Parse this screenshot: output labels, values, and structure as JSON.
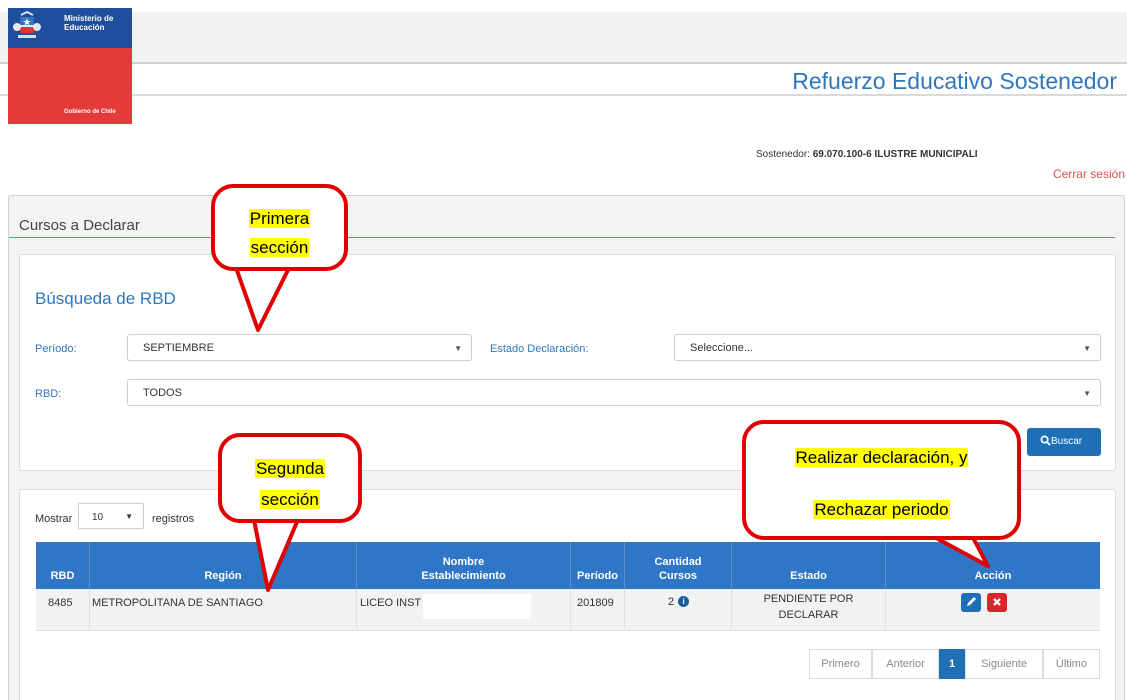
{
  "header": {
    "logo": {
      "line1": "Ministerio de",
      "line2": "Educación",
      "line3": "Gobierno de Chile"
    },
    "app_title": "Refuerzo Educativo Sostenedor",
    "sostenedor_label": "Sostenedor:",
    "sostenedor_value": "69.070.100-6 ILUSTRE MUNICIPALI",
    "logout": "Cerrar sesión"
  },
  "panel": {
    "title": "Cursos a Declarar"
  },
  "search": {
    "title": "Búsqueda de RBD",
    "periodo_label": "Período:",
    "periodo_value": "SEPTIEMBRE",
    "estado_label": "Estado Declaración:",
    "estado_value": "Seleccione...",
    "rbd_label": "RBD:",
    "rbd_value": "TODOS",
    "buscar_label": "Buscar"
  },
  "table": {
    "mostrar_label": "Mostrar",
    "page_length": "10",
    "registros_label": "registros",
    "columns": {
      "rbd": "RBD",
      "region": "Región",
      "nombre_l1": "Nombre",
      "nombre_l2": "Establecimiento",
      "periodo": "Período",
      "cantidad_l1": "Cantidad",
      "cantidad_l2": "Cursos",
      "estado": "Estado",
      "accion": "Acción"
    },
    "rows": [
      {
        "rbd": "8485",
        "region": "METROPOLITANA DE SANTIAGO",
        "nombre": "LICEO INST",
        "periodo": "201809",
        "cantidad": "2",
        "estado_l1": "PENDIENTE POR",
        "estado_l2": "DECLARAR"
      }
    ],
    "pagination": {
      "first": "Primero",
      "prev": "Anterior",
      "current": "1",
      "next": "Siguiente",
      "last": "Último"
    }
  },
  "annotations": {
    "primera_l1": "Primera",
    "primera_l2": "sección",
    "segunda_l1": "Segunda",
    "segunda_l2": "sección",
    "accion_l1": "Realizar declaración, y",
    "accion_l2": "Rechazar periodo"
  },
  "colors": {
    "brand_blue": "#2f77c6",
    "header_blue": "#1e4f9c",
    "gov_red": "#e53a3a",
    "annotation_red": "#e00000",
    "highlight": "#ffff00"
  },
  "icons": [
    "escudo-chile-icon",
    "search-icon",
    "info-icon",
    "edit-pencil-icon",
    "close-x-icon",
    "caret-down-icon"
  ]
}
